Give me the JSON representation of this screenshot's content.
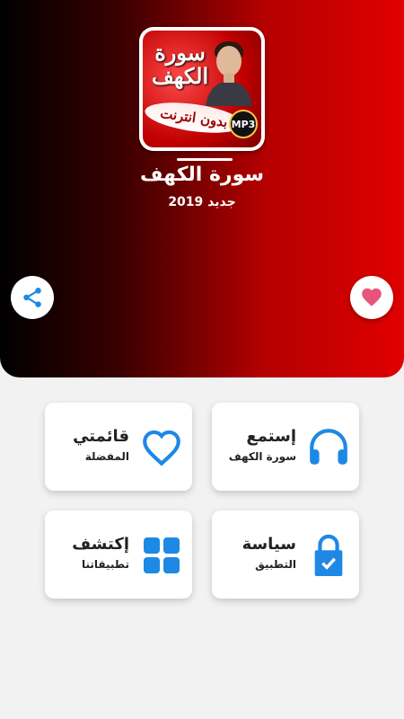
{
  "header": {
    "icon_title": "سورة\nالكهف",
    "icon_ribbon": "بدون انترنت",
    "icon_badge": "MP3",
    "title": "سورة الكهف",
    "subtitle": "جديد 2019",
    "share_icon": "share-icon",
    "favorite_icon": "heart-icon"
  },
  "cards": {
    "listen": {
      "title": "إستمع",
      "subtitle": "سورة الكهف",
      "icon": "headphones-icon"
    },
    "favorites": {
      "title": "قائمتي",
      "subtitle": "المفضلة",
      "icon": "heart-outline-icon"
    },
    "policy": {
      "title": "سياسة",
      "subtitle": "التطبيق",
      "icon": "lock-icon"
    },
    "explore": {
      "title": "إكتشف",
      "subtitle": "تطبيقاتنا",
      "icon": "grid-apps-icon"
    }
  },
  "colors": {
    "accent_blue": "#1e88e5",
    "hero_red": "#e00000",
    "heart_pink": "#e8557a"
  }
}
